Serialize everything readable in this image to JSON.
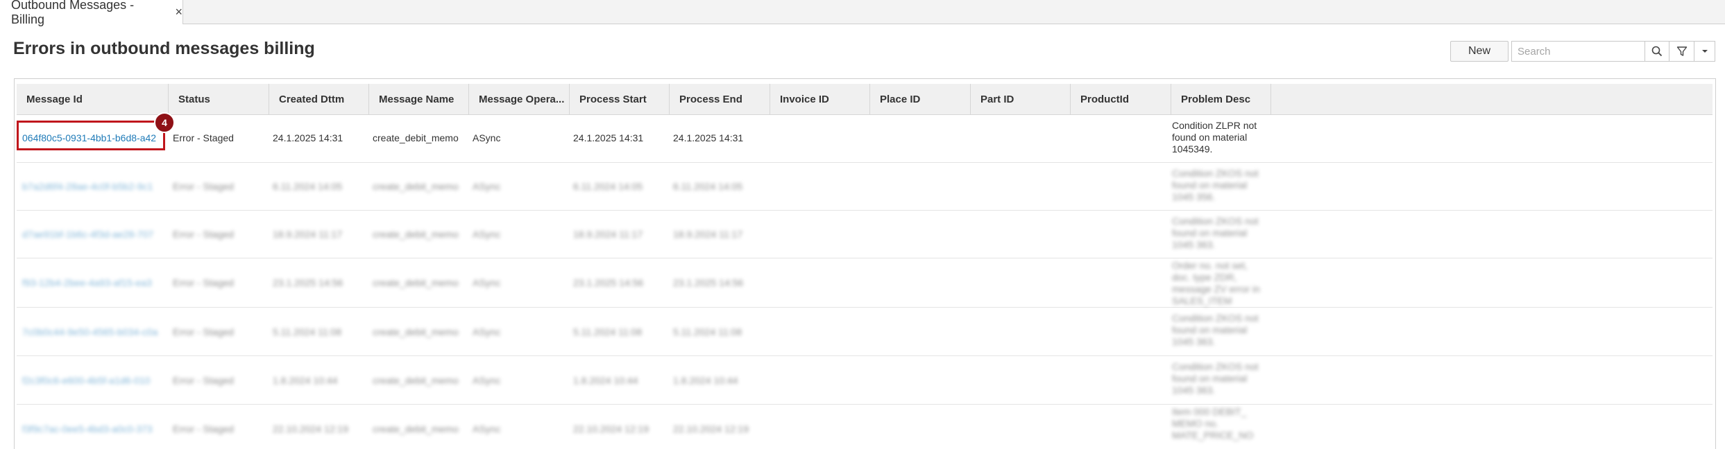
{
  "tab": {
    "label": "Outbound Messages - Billing",
    "close": "×"
  },
  "page": {
    "title": "Errors in outbound messages billing"
  },
  "toolbar": {
    "new_label": "New",
    "search_placeholder": "Search"
  },
  "grid": {
    "columns": [
      "Message Id",
      "Status",
      "Created Dttm",
      "Message Name",
      "Message Opera...",
      "Process Start",
      "Process End",
      "Invoice ID",
      "Place ID",
      "Part ID",
      "ProductId",
      "Problem Desc"
    ],
    "rows": [
      {
        "message_id": "064f80c5-0931-4bb1-b6d8-a42",
        "status": "Error - Staged",
        "created": "24.1.2025 14:31",
        "message_name": "create_debit_memo",
        "operation": "ASync",
        "process_start": "24.1.2025 14:31",
        "process_end": "24.1.2025 14:31",
        "problem_desc": "Condition ZLPR not found on material 1045349."
      },
      {
        "message_id": "b7a2d6f4-28ae-4c0f-b5b2-9c1",
        "status": "Error - Staged",
        "created": "6.11.2024 14:05",
        "message_name": "create_debit_memo",
        "operation": "ASync",
        "process_start": "6.11.2024 14:05",
        "process_end": "6.11.2024 14:05",
        "problem_desc": "Condition ZKOS not found on material 1045 356."
      },
      {
        "message_id": "d7ae91bf-1b6c-4f3d-ae28-707",
        "status": "Error - Staged",
        "created": "18.9.2024 11:17",
        "message_name": "create_debit_memo",
        "operation": "ASync",
        "process_start": "18.9.2024 11:17",
        "process_end": "18.9.2024 11:17",
        "problem_desc": "Condition ZKOS not found on material 1045 363."
      },
      {
        "message_id": "f93-12b4-2bee-4a93-af15-ea3",
        "status": "Error - Staged",
        "created": "23.1.2025 14:56",
        "message_name": "create_debit_memo",
        "operation": "ASync",
        "process_start": "23.1.2025 14:56",
        "process_end": "23.1.2025 14:56",
        "problem_desc": "Order no. not set, doc. type ZDR, message ZV error in SALES_ITEM reference doc."
      },
      {
        "message_id": "7c0b0c44-9e50-4565-b034-c0a",
        "status": "Error - Staged",
        "created": "5.11.2024 11:08",
        "message_name": "create_debit_memo",
        "operation": "ASync",
        "process_start": "5.11.2024 11:08",
        "process_end": "5.11.2024 11:08",
        "problem_desc": "Condition ZKOS not found on material 1045 363."
      },
      {
        "message_id": "f2c3f0c6-e600-4b5f-a1d6-010",
        "status": "Error - Staged",
        "created": "1.8.2024 10:44",
        "message_name": "create_debit_memo",
        "operation": "ASync",
        "process_start": "1.8.2024 10:44",
        "process_end": "1.8.2024 10:44",
        "problem_desc": "Condition ZKOS not found on material 1045 363."
      },
      {
        "message_id": "f3f9c7ac-0ee5-4bd3-a0c0-373",
        "status": "Error - Staged",
        "created": "22.10.2024 12:19",
        "message_name": "create_debit_memo",
        "operation": "ASync",
        "process_start": "22.10.2024 12:19",
        "process_end": "22.10.2024 12:19",
        "problem_desc": "Item 000 DEBIT_ MEMO no. MATE_PRICE_NO"
      }
    ]
  },
  "annotation": {
    "badge_number": "4"
  },
  "colors": {
    "link": "#1f7bb8",
    "highlight": "#c0161c",
    "badge": "#8f1116"
  }
}
